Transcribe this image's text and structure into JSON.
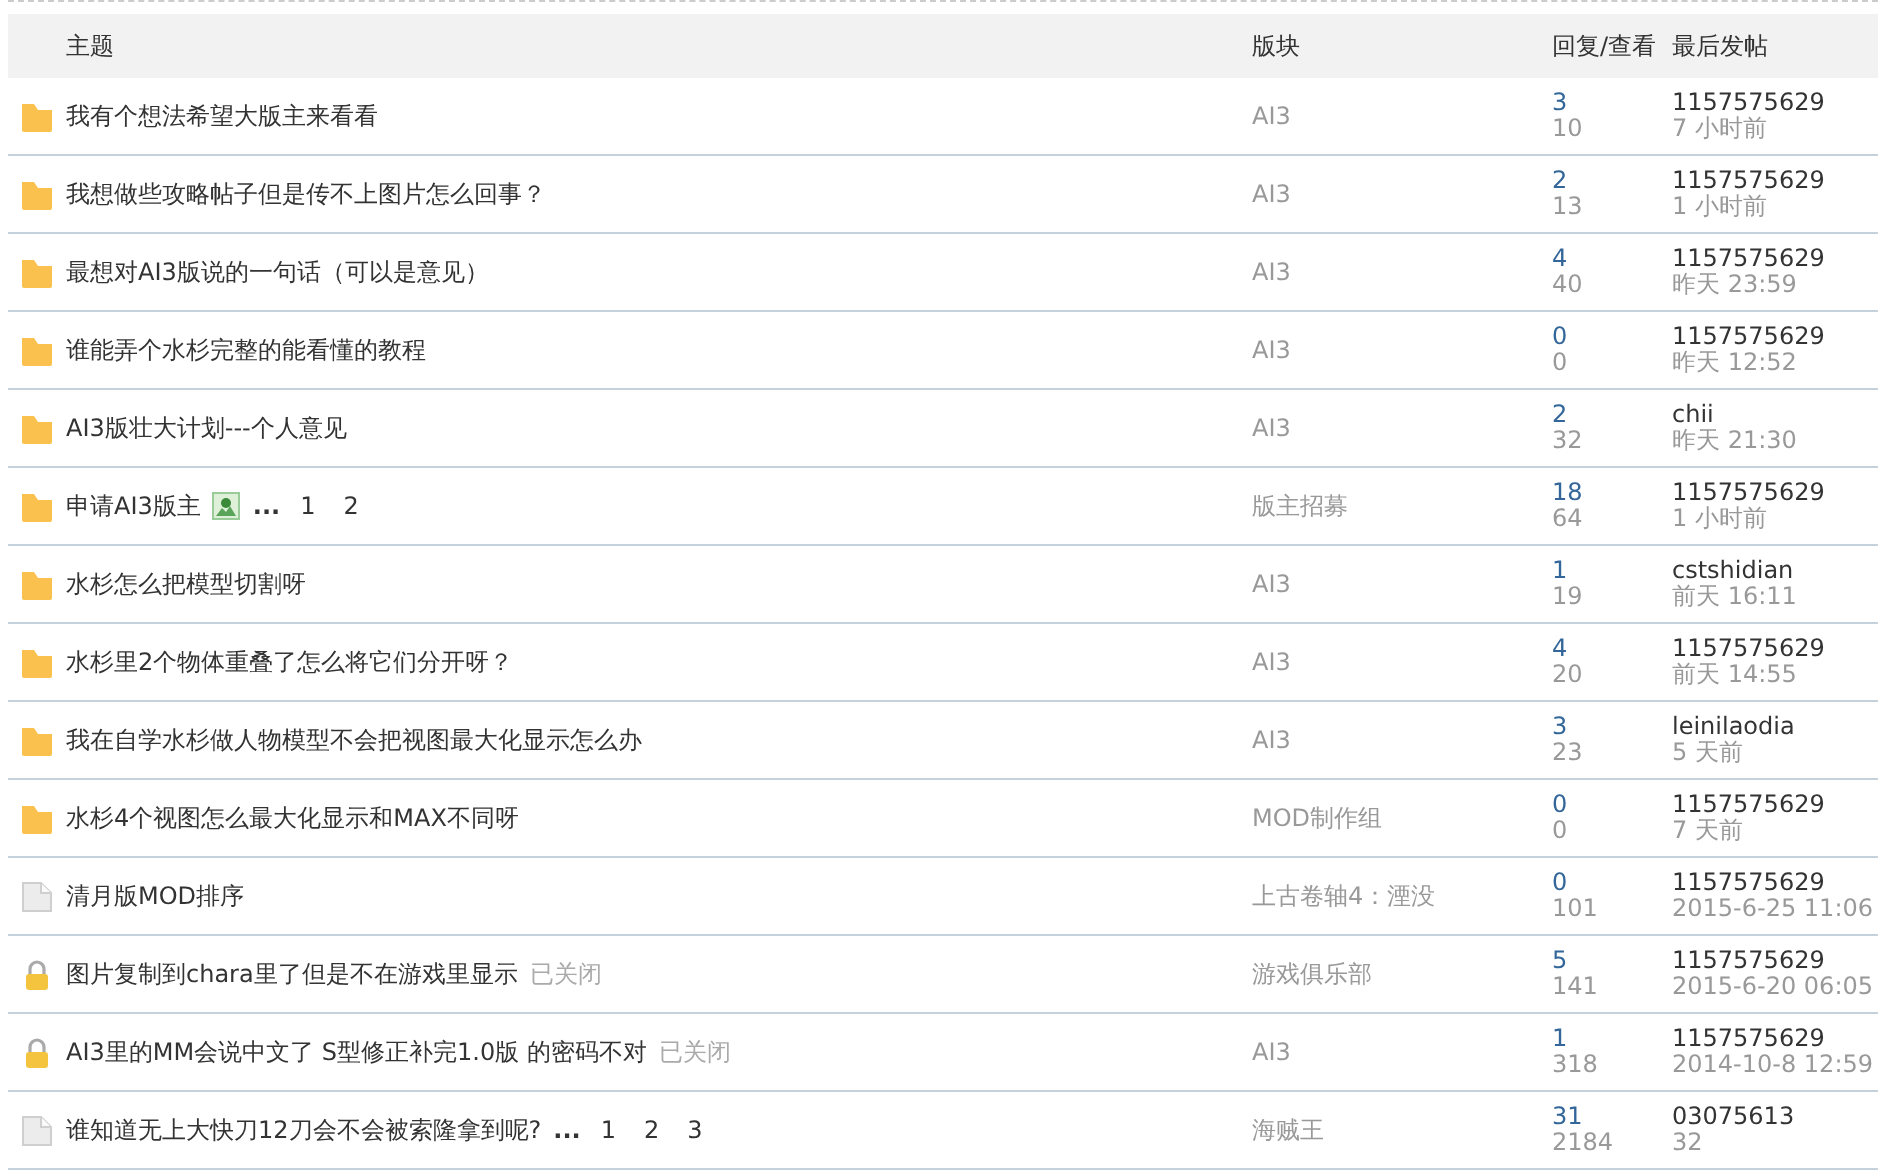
{
  "table": {
    "columns": [
      "主题",
      "版块",
      "回复/查看",
      "最后发帖"
    ],
    "rows": [
      {
        "kind": "folder",
        "title": "我有个想法希望大版主来看看",
        "forum": "AI3",
        "replies": "3",
        "views": "10",
        "author": "1157575629",
        "time": "7 小时前"
      },
      {
        "kind": "folder",
        "title": "我想做些攻略帖子但是传不上图片怎么回事？",
        "forum": "AI3",
        "replies": "2",
        "views": "13",
        "author": "1157575629",
        "time": "1 小时前"
      },
      {
        "kind": "folder",
        "title": "最想对AI3版说的一句话（可以是意见）",
        "forum": "AI3",
        "replies": "4",
        "views": "40",
        "author": "1157575629",
        "time": "昨天 23:59"
      },
      {
        "kind": "folder",
        "title": "谁能弄个水杉完整的能看懂的教程",
        "forum": "AI3",
        "replies": "0",
        "views": "0",
        "author": "1157575629",
        "time": "昨天 12:52"
      },
      {
        "kind": "folder",
        "title": "AI3版壮大计划---个人意见",
        "forum": "AI3",
        "replies": "2",
        "views": "32",
        "author": "chii",
        "time": "昨天 21:30"
      },
      {
        "kind": "folder",
        "title": "申请AI3版主",
        "has_image": true,
        "pages_prefix": "...",
        "pages": [
          "1",
          "2"
        ],
        "forum": "版主招募",
        "replies": "18",
        "views": "64",
        "author": "1157575629",
        "time": "1 小时前"
      },
      {
        "kind": "folder",
        "title": "水杉怎么把模型切割呀",
        "forum": "AI3",
        "replies": "1",
        "views": "19",
        "author": "cstshidian",
        "time": "前天 16:11"
      },
      {
        "kind": "folder",
        "title": "水杉里2个物体重叠了怎么将它们分开呀？",
        "forum": "AI3",
        "replies": "4",
        "views": "20",
        "author": "1157575629",
        "time": "前天 14:55"
      },
      {
        "kind": "folder",
        "title": "我在自学水杉做人物模型不会把视图最大化显示怎么办",
        "forum": "AI3",
        "replies": "3",
        "views": "23",
        "author": "leinilaodia",
        "time": "5 天前"
      },
      {
        "kind": "folder",
        "title": "水杉4个视图怎么最大化显示和MAX不同呀",
        "forum": "MOD制作组",
        "replies": "0",
        "views": "0",
        "author": "1157575629",
        "time": "7 天前"
      },
      {
        "kind": "file",
        "title": "清月版MOD排序",
        "forum": "上古卷轴4：湮没",
        "replies": "0",
        "views": "101",
        "author": "1157575629",
        "time": "2015-6-25 11:06"
      },
      {
        "kind": "lock",
        "title": "图片复制到chara里了但是不在游戏里显示",
        "status": "已关闭",
        "forum": "游戏俱乐部",
        "replies": "5",
        "views": "141",
        "author": "1157575629",
        "time": "2015-6-20 06:05"
      },
      {
        "kind": "lock",
        "title": "AI3里的MM会说中文了  S型修正补完1.0版 的密码不对",
        "status": "已关闭",
        "forum": "AI3",
        "replies": "1",
        "views": "318",
        "author": "1157575629",
        "time": "2014-10-8 12:59"
      },
      {
        "kind": "file",
        "title": "谁知道无上大快刀12刀会不会被索隆拿到呢?",
        "pages_prefix": "...",
        "pages": [
          "1",
          "2",
          "3"
        ],
        "forum": "海贼王",
        "replies": "31",
        "views": "2184",
        "author": "03075613",
        "time": "32"
      }
    ]
  }
}
